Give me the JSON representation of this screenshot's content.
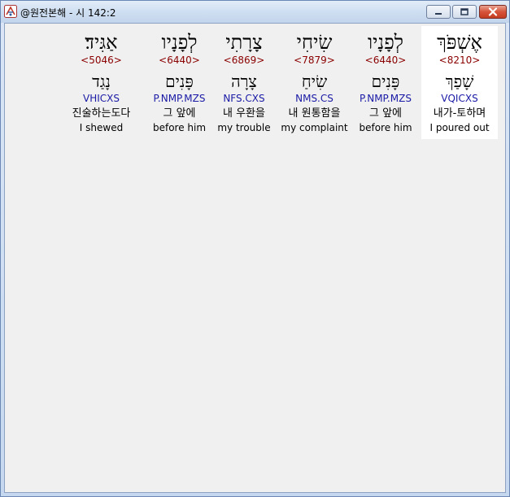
{
  "window": {
    "title": "@원전본해 - 시 142:2",
    "controls": {
      "minimize_icon": "minimize-icon",
      "maximize_icon": "maximize-icon",
      "close_icon": "close-icon"
    }
  },
  "colors": {
    "strong_number": "#8b0000",
    "morphology": "#1a1aa6",
    "selected_background": "#ffffff",
    "close_button": "#c43d22"
  },
  "words": [
    {
      "hebrew": "אַגִּיד׃",
      "strong": "<5046>",
      "root": "נָגַד",
      "morph": "VHICXS",
      "korean": "진술하는도다",
      "english": "I shewed",
      "selected": false
    },
    {
      "hebrew": "לְפָנָיו",
      "strong": "<6440>",
      "root": "פָּנִים",
      "morph": "P.NMP.MZS",
      "korean": "그 앞에",
      "english": "before him",
      "selected": false
    },
    {
      "hebrew": "צָרָתִי",
      "strong": "<6869>",
      "root": "צָרָה",
      "morph": "NFS.CXS",
      "korean": "내 우환을",
      "english": "my trouble",
      "selected": false
    },
    {
      "hebrew": "שִׂיחִי",
      "strong": "<7879>",
      "root": "שִׂיחַ",
      "morph": "NMS.CS",
      "korean": "내 원통함을",
      "english": "my complaint",
      "selected": false
    },
    {
      "hebrew": "לְפָנָיו",
      "strong": "<6440>",
      "root": "פָּנִים",
      "morph": "P.NMP.MZS",
      "korean": "그 앞에",
      "english": "before him",
      "selected": false
    },
    {
      "hebrew": "אֶשְׁפֹּךְ",
      "strong": "<8210>",
      "root": "שָׁפַךְ",
      "morph": "VQICXS",
      "korean": "내가-토하며",
      "english": "I poured out",
      "selected": true
    }
  ]
}
